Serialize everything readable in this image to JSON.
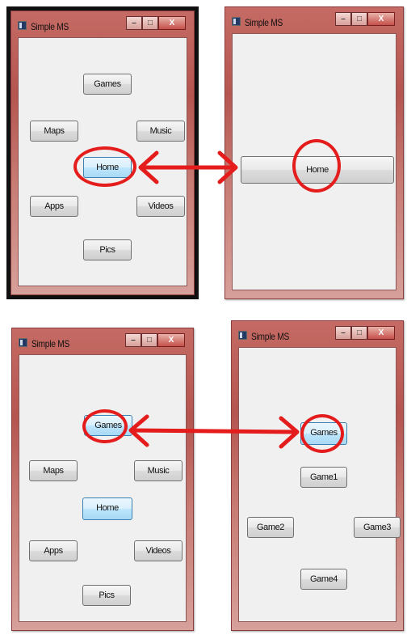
{
  "panels": [
    {
      "title": "Simple MS",
      "controls": {
        "minimize": "–",
        "maximize": "□",
        "close": "X"
      },
      "buttons": {
        "games": "Games",
        "maps": "Maps",
        "music": "Music",
        "home": "Home",
        "apps": "Apps",
        "videos": "Videos",
        "pics": "Pics"
      }
    },
    {
      "title": "Simple MS",
      "controls": {
        "minimize": "–",
        "maximize": "□",
        "close": "X"
      },
      "buttons": {
        "home": "Home"
      }
    },
    {
      "title": "Simple MS",
      "controls": {
        "minimize": "–",
        "maximize": "□",
        "close": "X"
      },
      "buttons": {
        "games": "Games",
        "maps": "Maps",
        "music": "Music",
        "home": "Home",
        "apps": "Apps",
        "videos": "Videos",
        "pics": "Pics"
      }
    },
    {
      "title": "Simple MS",
      "controls": {
        "minimize": "–",
        "maximize": "□",
        "close": "X"
      },
      "buttons": {
        "games": "Games",
        "game1": "Game1",
        "game2": "Game2",
        "game3": "Game3",
        "game4": "Game4"
      }
    }
  ],
  "colors": {
    "annotation": "#e41c1c",
    "frame": "#b55550",
    "active_button": "#bee6fd"
  }
}
